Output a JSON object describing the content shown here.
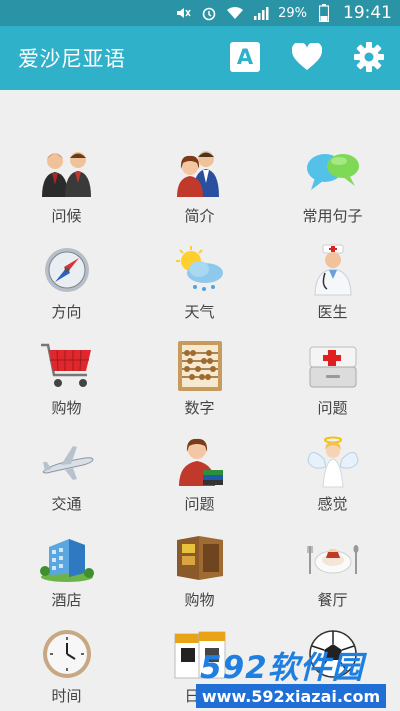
{
  "status_bar": {
    "battery": "29%",
    "time": "19:41",
    "icons": [
      "mute-icon",
      "alarm-icon",
      "wifi-icon",
      "signal-icon",
      "battery-icon"
    ]
  },
  "app_bar": {
    "title": "爱沙尼亚语",
    "actions": [
      "font-icon",
      "heart-icon",
      "gear-icon"
    ],
    "font_label": "A"
  },
  "categories": [
    {
      "label": "问候",
      "icon": "people-greeting-icon"
    },
    {
      "label": "简介",
      "icon": "couple-icon"
    },
    {
      "label": "常用句子",
      "icon": "speech-bubbles-icon"
    },
    {
      "label": "方向",
      "icon": "compass-icon"
    },
    {
      "label": "天气",
      "icon": "weather-icon"
    },
    {
      "label": "医生",
      "icon": "doctor-icon"
    },
    {
      "label": "购物",
      "icon": "shopping-cart-icon"
    },
    {
      "label": "数字",
      "icon": "abacus-icon"
    },
    {
      "label": "问题",
      "icon": "first-aid-kit-icon"
    },
    {
      "label": "交通",
      "icon": "airplane-icon"
    },
    {
      "label": "问题",
      "icon": "woman-books-icon"
    },
    {
      "label": "感觉",
      "icon": "angel-icon"
    },
    {
      "label": "酒店",
      "icon": "hotel-icon"
    },
    {
      "label": "购物",
      "icon": "wallet-icon"
    },
    {
      "label": "餐厅",
      "icon": "dining-icon"
    },
    {
      "label": "时间",
      "icon": "clock-icon"
    },
    {
      "label": "日期",
      "icon": "calendar-icon"
    },
    {
      "label": "",
      "icon": "football-icon"
    }
  ],
  "watermark": {
    "brand": "592软件园",
    "url": "www.592xiazai.com"
  }
}
